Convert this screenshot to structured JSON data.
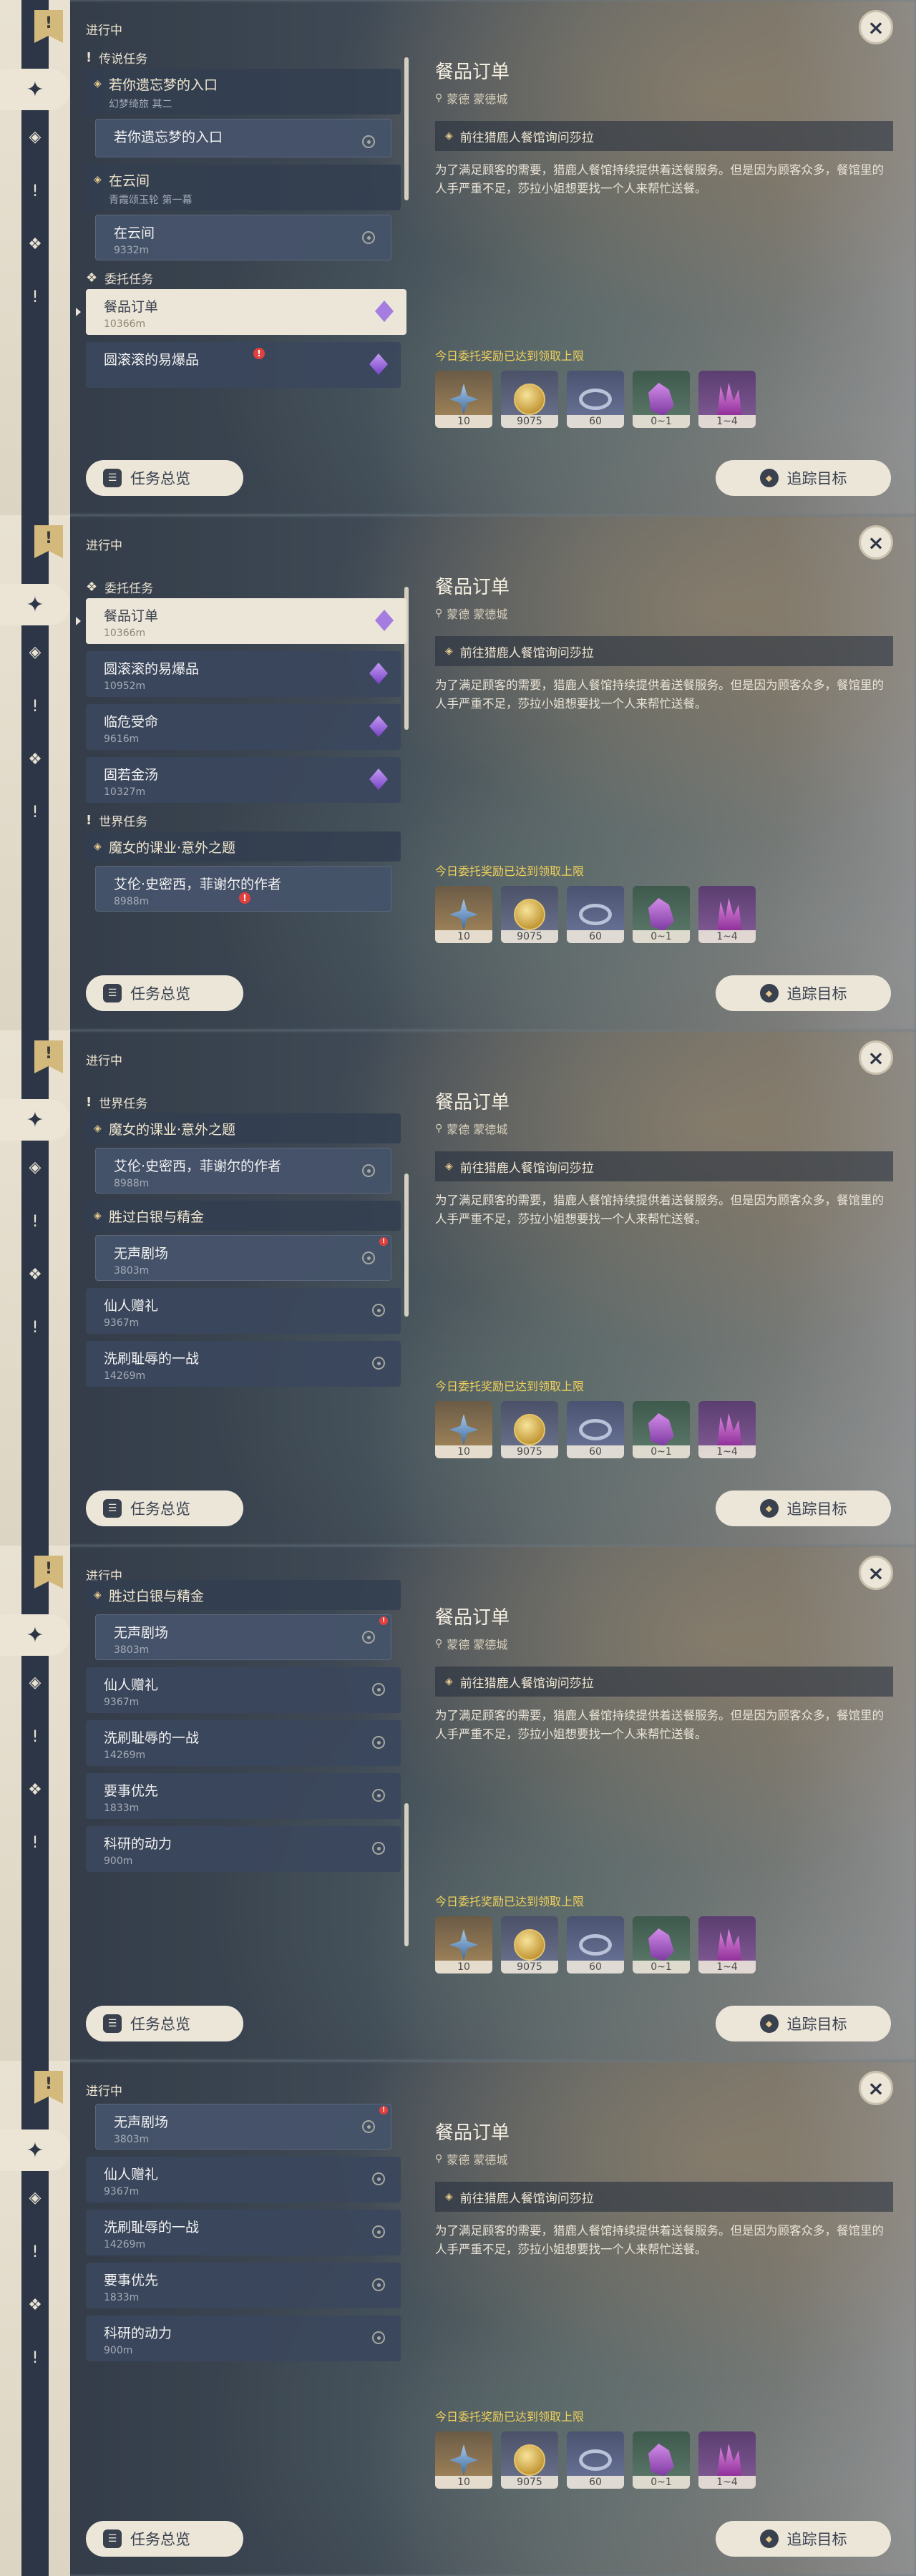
{
  "common": {
    "status_label": "进行中",
    "overview_button": "任务总览",
    "track_button": "追踪目标",
    "close_symbol": "×"
  },
  "detail": {
    "title": "餐品订单",
    "location": "蒙德 蒙德城",
    "objective": "前往猎鹿人餐馆询问莎拉",
    "description": "为了满足顾客的需要，猎鹿人餐馆持续提供着送餐服务。但是因为顾客众多，餐馆里的人手严重不足，莎拉小姐想要找一个人来帮忙送餐。",
    "reward_notice": "今日委托奖励已达到领取上限",
    "rewards": [
      {
        "icon": "adventure-exp-icon",
        "qty": "10"
      },
      {
        "icon": "mora-icon",
        "qty": "9075"
      },
      {
        "icon": "reputation-icon",
        "qty": "60"
      },
      {
        "icon": "ore-icon",
        "qty": "0~1"
      },
      {
        "icon": "crystal-icon",
        "qty": "1~4"
      }
    ]
  },
  "frames": [
    {
      "sections": {
        "legend": "传说任务",
        "commission": "委托任务"
      },
      "quests": {
        "q1_title": "若你遗忘梦的入口",
        "q1_sub": "幻梦绮旅 其二",
        "q1_item": "若你遗忘梦的入口",
        "q2_title": "在云间",
        "q2_sub": "青霞颂玉轮 第一幕",
        "q2_item": "在云间",
        "q2_item_dist": "9332m",
        "c1_title": "餐品订单",
        "c1_dist": "10366m",
        "c2_title": "圆滚滚的易爆品"
      }
    },
    {
      "sections": {
        "commission": "委托任务",
        "world": "世界任务"
      },
      "quests": {
        "c1_title": "餐品订单",
        "c1_dist": "10366m",
        "c2_title": "圆滚滚的易爆品",
        "c2_dist": "10952m",
        "c3_title": "临危受命",
        "c3_dist": "9616m",
        "c4_title": "固若金汤",
        "c4_dist": "10327m",
        "w1_title": "魔女的课业·意外之题",
        "w1_item": "艾伦·史密西，菲谢尔的作者",
        "w1_item_dist": "8988m"
      }
    },
    {
      "sections": {
        "world": "世界任务"
      },
      "quests": {
        "w1_title": "魔女的课业·意外之题",
        "w1_item": "艾伦·史密西，菲谢尔的作者",
        "w1_item_dist": "8988m",
        "w2_title": "胜过白银与精金",
        "w2_item": "无声剧场",
        "w2_item_dist": "3803m",
        "w3_title": "仙人赠礼",
        "w3_dist": "9367m",
        "w4_title": "洗刷耻辱的一战",
        "w4_dist": "14269m"
      }
    },
    {
      "quests": {
        "w2_title": "胜过白银与精金",
        "w2_item": "无声剧场",
        "w2_item_dist": "3803m",
        "w3_title": "仙人赠礼",
        "w3_dist": "9367m",
        "w4_title": "洗刷耻辱的一战",
        "w4_dist": "14269m",
        "w5_title": "要事优先",
        "w5_dist": "1833m",
        "w6_title": "科研的动力",
        "w6_dist": "900m"
      }
    },
    {
      "quests": {
        "w2_item": "无声剧场",
        "w2_item_dist": "3803m",
        "w3_title": "仙人赠礼",
        "w3_dist": "9367m",
        "w4_title": "洗刷耻辱的一战",
        "w4_dist": "14269m",
        "w5_title": "要事优先",
        "w5_dist": "1833m",
        "w6_title": "科研的动力",
        "w6_dist": "900m"
      }
    }
  ]
}
